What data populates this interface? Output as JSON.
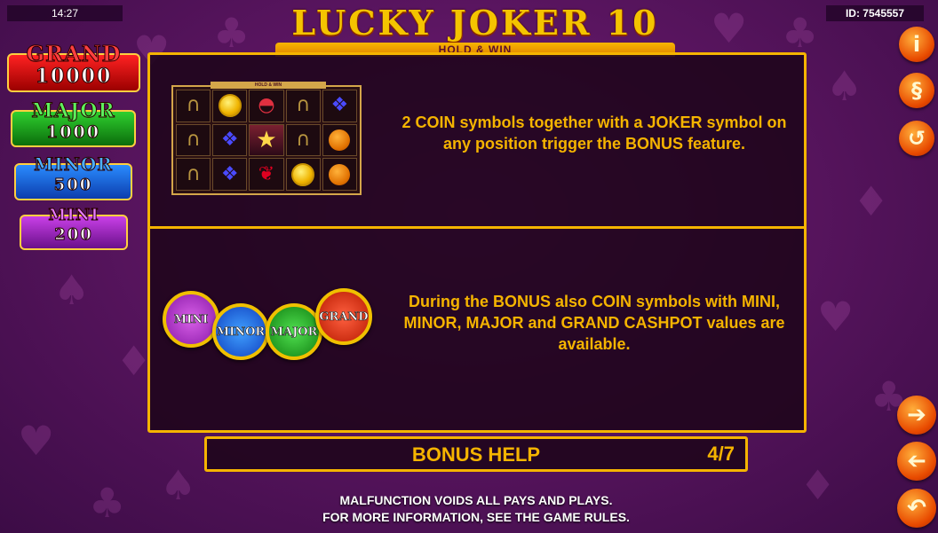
{
  "status_bar": {
    "time": "14:27",
    "game_id": "ID: 7545557"
  },
  "logo": {
    "title": "LUCKY JOKER 10",
    "subtitle": "HOLD & WIN"
  },
  "jackpots": [
    {
      "name": "GRAND",
      "value": "10000",
      "color": "#e01010"
    },
    {
      "name": "MAJOR",
      "value": "1000",
      "color": "#1fa51f"
    },
    {
      "name": "MINOR",
      "value": "500",
      "color": "#1a5fe0"
    },
    {
      "name": "MINI",
      "value": "200",
      "color": "#9b22c4"
    }
  ],
  "side_buttons": {
    "info_icon": "i",
    "rules_icon": "§",
    "history_icon": "history-icon",
    "next_icon": "arrow-right-icon",
    "prev_icon": "arrow-left-icon",
    "back_icon": "return-icon"
  },
  "help": {
    "section1_text": "2 COIN symbols together with a JOKER symbol on any position trigger the BONUS feature.",
    "section2_text": "During the BONUS also COIN symbols with MINI, MINOR, MAJOR and GRAND CASHPOT values are available.",
    "mini_reels_header": "HOLD & WIN",
    "reels": [
      [
        "horseshoe",
        "coin",
        "watermelon",
        "horseshoe",
        "grapes"
      ],
      [
        "horseshoe",
        "grapes",
        "joker",
        "horseshoe",
        "orange"
      ],
      [
        "horseshoe",
        "grapes",
        "cherry",
        "coin",
        "orange"
      ]
    ],
    "coins": [
      "MINI",
      "MINOR",
      "MAJOR",
      "GRAND"
    ],
    "page_title": "BONUS HELP",
    "page_counter": "4/7"
  },
  "footer": {
    "line1": "MALFUNCTION VOIDS ALL PAYS AND PLAYS.",
    "line2": "FOR MORE INFORMATION, SEE THE GAME RULES."
  },
  "colors": {
    "accent": "#f5b400",
    "background": "#5a1560"
  }
}
